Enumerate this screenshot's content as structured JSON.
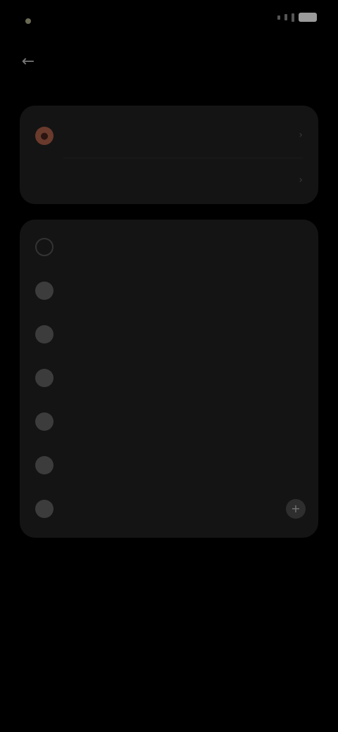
{
  "status_bar": {
    "time": "",
    "battery_icon": "battery-icon",
    "signal_icon": "signal-icon"
  },
  "app_bar": {
    "back_icon": "back-arrow-icon",
    "title": ""
  },
  "account_card": {
    "items": [
      {
        "icon": "avatar-icon",
        "label": ""
      },
      {
        "icon": "person-icon",
        "label": ""
      }
    ]
  },
  "settings_card": {
    "items": [
      {
        "icon": "search-icon",
        "label": ""
      },
      {
        "icon": "settings-icon",
        "label": ""
      },
      {
        "icon": "settings-icon",
        "label": ""
      },
      {
        "icon": "settings-icon",
        "label": ""
      },
      {
        "icon": "settings-icon",
        "label": ""
      },
      {
        "icon": "settings-icon",
        "label": ""
      },
      {
        "icon": "settings-icon",
        "label": "",
        "value": "",
        "action_icon": "plus-icon"
      }
    ]
  },
  "footer": {
    "link": ""
  },
  "colors": {
    "background": "#000000",
    "card": "#141414",
    "accent": "#6a3a2c"
  }
}
